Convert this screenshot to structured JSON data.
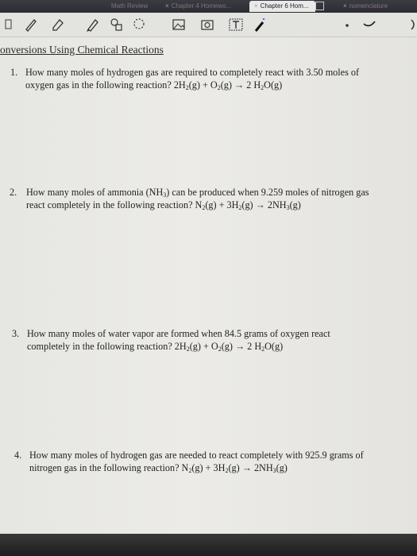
{
  "tabs": [
    {
      "label": "Math Review"
    },
    {
      "label": "Chapter 4 Homewo..."
    },
    {
      "label": "Chapter 6 Hom..."
    },
    {
      "label": "nomenclature"
    }
  ],
  "toolbar": {
    "tools": [
      "pen-icon",
      "highlighter-icon",
      "marker-icon",
      "shapes-icon",
      "lasso-icon",
      "image-icon",
      "camera-icon",
      "text-icon",
      "bluetooth-pencil-icon",
      "color-dot-icon",
      "curve-icon"
    ]
  },
  "document": {
    "heading": "onversions Using Chemical Reactions",
    "questions": [
      {
        "number": "1.",
        "line1": "How many moles of hydrogen gas are required to completely react with 3.50 moles of",
        "line2_prefix": "oxygen gas in the following reaction?  2H",
        "line2_rest": "(g) + O",
        "line2_rest2": "(g) → 2 H",
        "line2_end": "O(g)"
      },
      {
        "number": "2.",
        "line1_a": "How many moles of ammonia (NH",
        "line1_b": ") can be produced when 9.259 moles of nitrogen gas",
        "line2_a": "react completely in the following reaction?  N",
        "line2_b": "(g) + 3H",
        "line2_c": "(g) → 2NH",
        "line2_d": "(g)"
      },
      {
        "number": "3.",
        "line1": "How many moles of water vapor are formed when 84.5 grams of oxygen react",
        "line2_a": "completely in the following reaction?  2H",
        "line2_b": "(g) + O",
        "line2_c": "(g) → 2 H",
        "line2_d": "O(g)"
      },
      {
        "number": "4.",
        "line1": "How many moles of hydrogen gas are needed to react completely with 925.9 grams of",
        "line2_a": "nitrogen gas in the following reaction?  N",
        "line2_b": "(g) + 3H",
        "line2_c": "(g) → 2NH",
        "line2_d": "(g)"
      }
    ],
    "sub2": "2",
    "sub3": "3"
  }
}
